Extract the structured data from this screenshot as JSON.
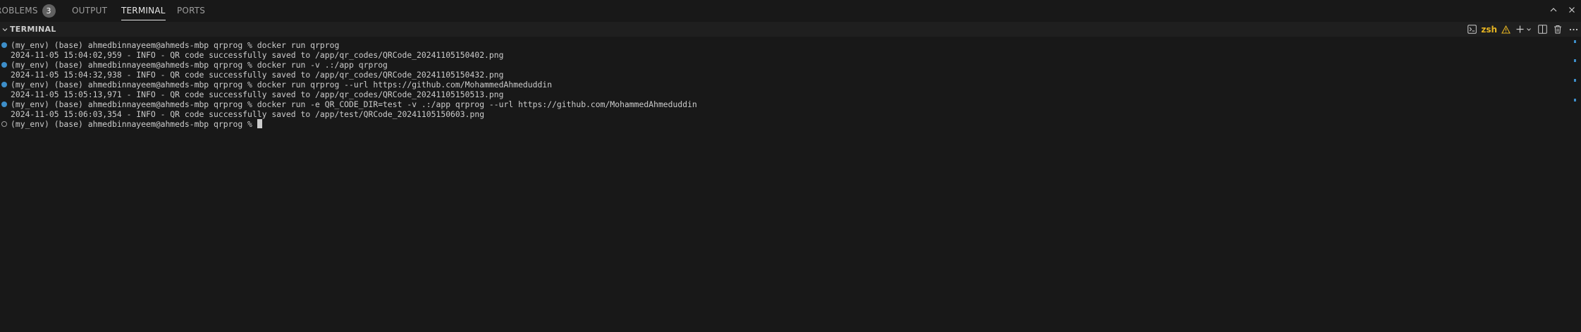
{
  "tabs": [
    {
      "label": "ROBLEMS",
      "badge": "3"
    },
    {
      "label": "OUTPUT"
    },
    {
      "label": "TERMINAL"
    },
    {
      "label": "PORTS"
    }
  ],
  "section": {
    "title": "TERMINAL",
    "shell_label": "zsh"
  },
  "terminal": {
    "lines": [
      {
        "status": "success",
        "text": "(my_env) (base) ahmedbinnayeem@ahmeds-mbp qrprog % docker run qrprog"
      },
      {
        "status": "none",
        "text": "2024-11-05 15:04:02,959 - INFO - QR code successfully saved to /app/qr_codes/QRCode_20241105150402.png"
      },
      {
        "status": "success",
        "text": "(my_env) (base) ahmedbinnayeem@ahmeds-mbp qrprog % docker run -v .:/app qrprog"
      },
      {
        "status": "none",
        "text": "2024-11-05 15:04:32,938 - INFO - QR code successfully saved to /app/qr_codes/QRCode_20241105150432.png"
      },
      {
        "status": "success",
        "text": "(my_env) (base) ahmedbinnayeem@ahmeds-mbp qrprog % docker run qrprog --url https://github.com/MohammedAhmeduddin"
      },
      {
        "status": "none",
        "text": "2024-11-05 15:05:13,971 - INFO - QR code successfully saved to /app/qr_codes/QRCode_20241105150513.png"
      },
      {
        "status": "success",
        "text": "(my_env) (base) ahmedbinnayeem@ahmeds-mbp qrprog % docker run -e QR_CODE_DIR=test -v .:/app qrprog --url https://github.com/MohammedAhmeduddin"
      },
      {
        "status": "none",
        "text": "2024-11-05 15:06:03,354 - INFO - QR code successfully saved to /app/test/QRCode_20241105150603.png"
      },
      {
        "status": "pending",
        "text": "(my_env) (base) ahmedbinnayeem@ahmeds-mbp qrprog % "
      }
    ]
  },
  "icons": {
    "maximize": "chevron-up-icon",
    "close": "close-icon",
    "shell": "terminal-icon",
    "warning": "warning-icon",
    "new": "plus-icon",
    "split": "split-icon",
    "kill": "trash-icon",
    "more": "ellipsis-icon"
  },
  "colors": {
    "background": "#181818",
    "shell_accent": "#e6b422",
    "decoration_success": "#3d8ec9"
  }
}
